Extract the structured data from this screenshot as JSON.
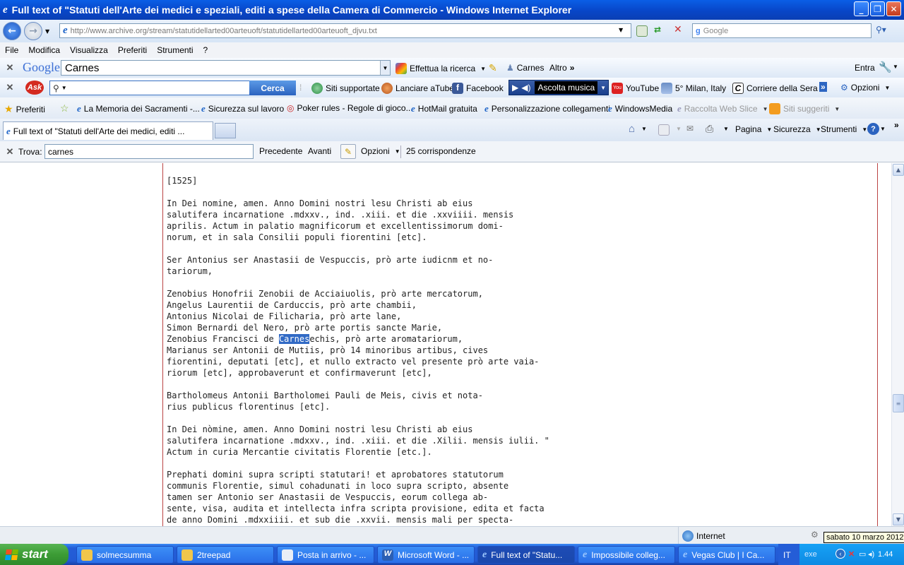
{
  "window": {
    "title": "Full text of \"Statuti dell'Arte dei medici e speziali, editi a spese della Camera di Commercio  - Windows Internet Explorer"
  },
  "address": {
    "url": "http://www.archive.org/stream/statutidellarted00arteuoft/statutidellarted00arteuoft_djvu.txt",
    "search_placeholder": "Google"
  },
  "menu": [
    "File",
    "Modifica",
    "Visualizza",
    "Preferiti",
    "Strumenti",
    "?"
  ],
  "google_toolbar": {
    "logo": "Google",
    "query": "Carnes",
    "search_btn": "Effettua la ricerca",
    "term": "Carnes",
    "altro": "Altro",
    "entra": "Entra"
  },
  "ask_toolbar": {
    "logo": "Ask",
    "cerca": "Cerca",
    "siti": "Siti supportate",
    "atube": "Lanciare aTube",
    "facebook": "Facebook",
    "ascolta": "Ascolta musica",
    "youtube": "YouTube",
    "weather": "5° Milan, Italy",
    "corriere": "Corriere della Sera",
    "opzioni": "Opzioni"
  },
  "favorites": {
    "label": "Preferiti",
    "items": [
      "La Memoria dei Sacramenti -...",
      "Sicurezza sul lavoro",
      "Poker rules - Regole di gioco...",
      "HotMail gratuita",
      "Personalizzazione collegamenti",
      "WindowsMedia",
      "Raccolta Web Slice",
      "Siti suggeriti"
    ]
  },
  "tab": {
    "label": "Full text of \"Statuti dell'Arte dei medici, editi ..."
  },
  "commandbar": {
    "pagina": "Pagina",
    "sicurezza": "Sicurezza",
    "strumenti": "Strumenti"
  },
  "find": {
    "label": "Trova:",
    "value": "carnes",
    "prev": "Precedente",
    "next": "Avanti",
    "options": "Opzioni",
    "matches": "25 corrispondenze"
  },
  "document": {
    "before": "[1525]\n\nIn Dei nomine, amen. Anno Domini nostri lesu Christi ab eius\nsalutifera incarnatione .mdxxv., ind. .xiii. et die .xxviiii. mensis\naprilis. Actum in palatio magnificorum et excellentissimorum domi-\nnorum, et in sala Consilii populi fiorentini [etc].\n\nSer Antonius ser Anastasii de Vespuccis, prò arte iudicnm et no-\ntariorum,\n\nZenobius Honofrii Zenobii de Acciaiuolis, prò arte mercatorum,\nAngelus Laurentii de Carduccis, prò arte chambii,\nAntonius Nicolai de Filicharia, prò arte lane,\nSimon Bernardi del Nero, prò arte portis sancte Marie,\nZenobius Francisci de ",
    "highlight": "Carnes",
    "after": "echis, prò arte aromatariorum,\nMarianus ser Antonii de Mutiis, prò 14 minoribus artibus, cives\nfiorentini, deputati [etc], et nullo extracto vel presente prò arte vaia-\nriorum [etc], approbaverunt et confirmaverunt [etc],\n\nBartholomeus Antonii Bartholomei Pauli de Meis, civis et nota-\nrius publicus florentinus [etc].\n\nIn Dei nòmine, amen. Anno Domini nostri lesu Christi ab eius\nsalutifera incarnatione .mdxxv., ind. .xiii. et die .Xilii. mensis iulii. \"\nActum in curia Mercantie civitatis Florentie [etc.].\n\nPrephati domini supra scripti statutari! et aprobatores statutorum\ncommunis Florentie, simul cohadunati in loco supra scripto, absente\ntamen ser Antonio ser Anastasii de Vespuccis, eorum collega ab-\nsente, visa, audita et intellecta infra scripta provisione, edita et facta\nde anno Domini .mdxxiiii. et sub die .xxvii. mensis mali per specta-"
  },
  "status": {
    "zone": "Internet"
  },
  "taskbar": {
    "start": "start",
    "tasks": [
      "solmecsumma",
      "2treepad",
      "Posta in arrivo - ...",
      "Microsoft Word - ...",
      "Full text of \"Statu...",
      "Impossibile colleg...",
      "Vegas Club | I Ca..."
    ],
    "lang": "IT",
    "exe": "exe",
    "time": "1.44"
  },
  "tooltip": "sabato 10 marzo 2012"
}
